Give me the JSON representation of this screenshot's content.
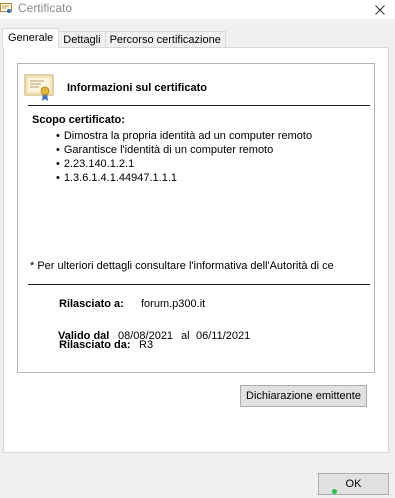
{
  "window": {
    "title": "Certificato",
    "close_glyph": "✕"
  },
  "tabs": [
    {
      "label": "Generale",
      "active": true
    },
    {
      "label": "Dettagli",
      "active": false
    },
    {
      "label": "Percorso certificazione",
      "active": false
    }
  ],
  "info": {
    "icon": "certificate-icon",
    "title": "Informazioni sul certificato",
    "scope_label": "Scopo certificato:",
    "purposes": [
      "Dimostra la propria identità ad un computer remoto",
      "Garantisce l'identità di un computer remoto",
      "2.23.140.1.2.1",
      "1.3.6.1.4.1.44947.1.1.1"
    ],
    "footnote": "* Per ulteriori dettagli consultare l'informativa dell'Autorità di ce"
  },
  "fields": {
    "issued_to_label": "Rilasciato a:",
    "issued_to_value": "forum.p300.it",
    "issued_by_label": "Rilasciato da:",
    "issued_by_value": "R3",
    "valid_from_label": "Valido dal",
    "valid_from_value": "08/08/2021",
    "valid_to_label": "al",
    "valid_to_value": "06/11/2021"
  },
  "buttons": {
    "issuer_statement": "Dichiarazione emittente",
    "ok": "OK"
  },
  "colors": {
    "accent": "#0078d7",
    "ok_indicator": "#27c24c"
  }
}
